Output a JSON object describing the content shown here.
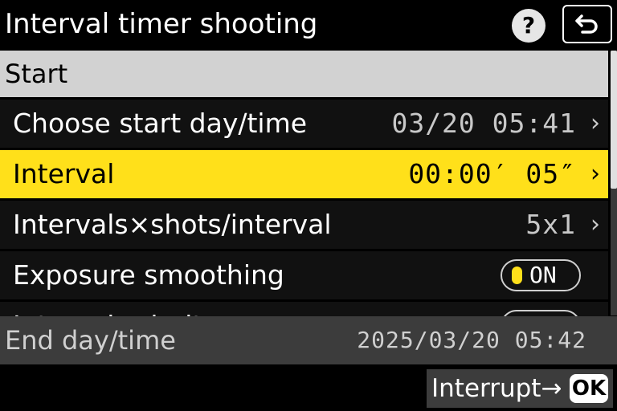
{
  "header": {
    "title": "Interval timer shooting",
    "help_label": "?"
  },
  "section": {
    "label": "Start"
  },
  "menu": {
    "items": [
      {
        "label": "Choose start day/time",
        "value": "03/20  05:41"
      },
      {
        "label": "Interval",
        "value": "00:00′ 05″"
      },
      {
        "label": "Intervals×shots/interval",
        "value": "5x1"
      },
      {
        "label": "Exposure smoothing",
        "toggle": "ON"
      },
      {
        "label": "Interval priority",
        "toggle": "ON"
      }
    ]
  },
  "end": {
    "label": "End day/time",
    "value": "2025/03/20  05:42"
  },
  "footer": {
    "interrupt_label": "Interrupt→",
    "ok_label": "OK"
  },
  "colors": {
    "highlight": "#ffe01a",
    "section_bg": "#d2d2d2",
    "bar_bg": "#3c3c3c"
  },
  "icons": {
    "help": "help-icon",
    "back": "back-arrow-icon",
    "chevron": "chevron-right-icon",
    "ok": "ok-button-icon"
  }
}
